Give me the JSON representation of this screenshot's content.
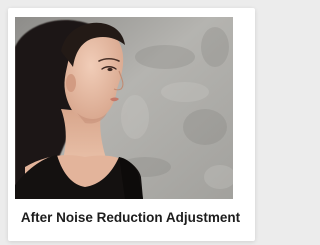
{
  "figure": {
    "image_alt": "Portrait photo of a woman in a black sleeveless top against a grey textured wall",
    "caption": "After Noise Reduction Adjustment"
  }
}
